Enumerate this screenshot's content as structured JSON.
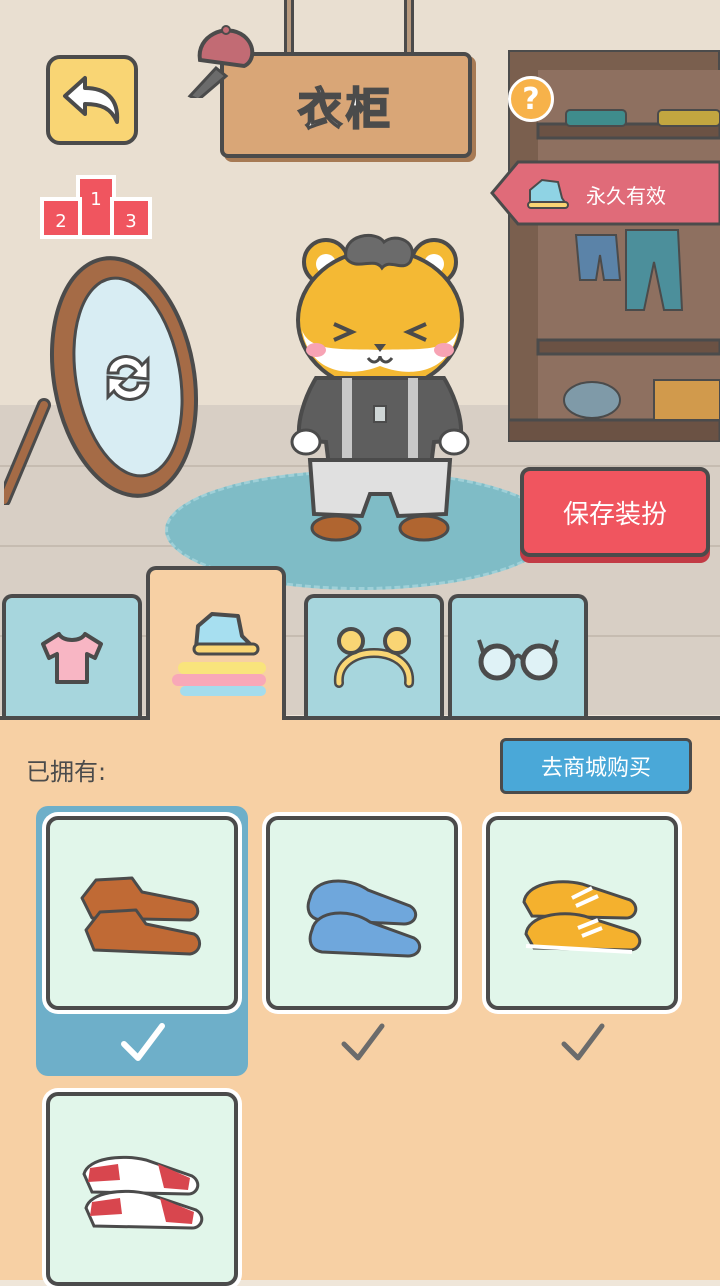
{
  "header": {
    "title": "衣柜",
    "back_icon": "back-arrow-icon",
    "help_icon": "?"
  },
  "podium": {
    "first": "1",
    "second": "2",
    "third": "3"
  },
  "validity_tag": {
    "text": "永久有效"
  },
  "save_button": {
    "label": "保存装扮"
  },
  "tabs": [
    {
      "name": "tops",
      "icon": "shirt-icon",
      "active": false
    },
    {
      "name": "shoes",
      "icon": "shoe-icon",
      "active": true
    },
    {
      "name": "headwear",
      "icon": "headband-icon",
      "active": false
    },
    {
      "name": "glasses",
      "icon": "glasses-icon",
      "active": false
    }
  ],
  "panel": {
    "owned_label": "已拥有:",
    "shop_label": "去商城购买",
    "items": [
      {
        "name": "brown leather shoes",
        "icon": "brown-shoes-icon",
        "owned": true,
        "selected": true
      },
      {
        "name": "blue slip-on shoes",
        "icon": "blue-shoes-icon",
        "owned": true,
        "selected": false
      },
      {
        "name": "yellow sneakers",
        "icon": "yellow-sneakers-icon",
        "owned": true,
        "selected": false
      },
      {
        "name": "red and white sneakers",
        "icon": "red-sneakers-icon",
        "owned": false,
        "selected": false
      }
    ]
  },
  "colors": {
    "accent_red": "#f0555f",
    "tab_blue": "#a7d6dd",
    "panel": "#f7d0a4",
    "shop_blue": "#4aa8d8",
    "selected": "#6eafc9"
  }
}
